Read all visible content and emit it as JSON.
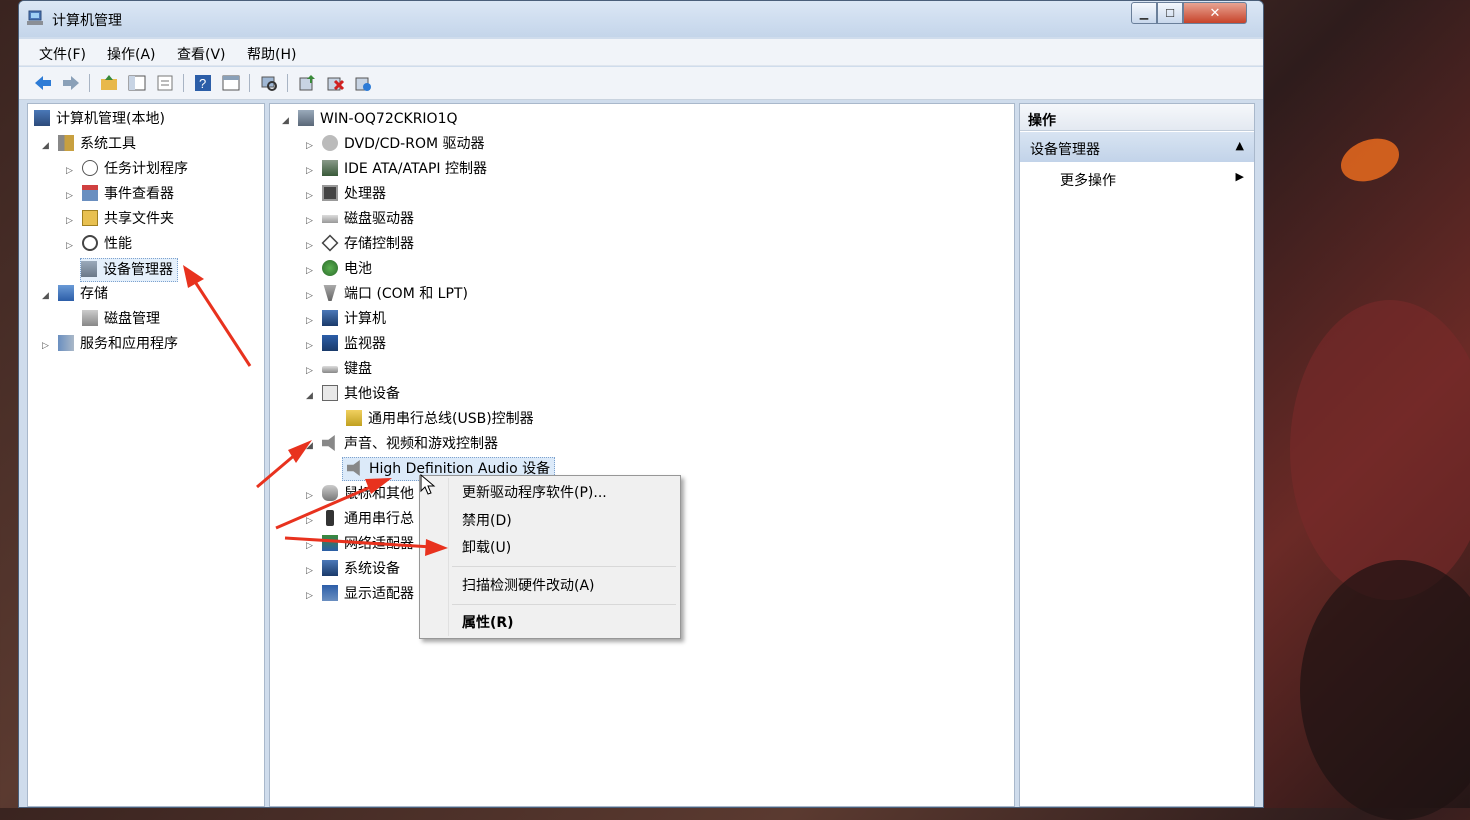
{
  "window": {
    "title": "计算机管理"
  },
  "menubar": [
    "文件(F)",
    "操作(A)",
    "查看(V)",
    "帮助(H)"
  ],
  "toolbar_icons": [
    "back-icon",
    "forward-icon",
    "up-folder-icon",
    "show-tree-icon",
    "export-icon",
    "help-icon",
    "console-tree-icon",
    "scan-icon",
    "update-driver-icon",
    "uninstall-icon",
    "enable-icon"
  ],
  "left_tree": {
    "root": "计算机管理(本地)",
    "system_tools": "系统工具",
    "task_scheduler": "任务计划程序",
    "event_viewer": "事件查看器",
    "shared_folders": "共享文件夹",
    "performance": "性能",
    "device_manager": "设备管理器",
    "storage": "存储",
    "disk_management": "磁盘管理",
    "services_apps": "服务和应用程序"
  },
  "device_tree": {
    "root": "WIN-OQ72CKRIO1Q",
    "dvd": "DVD/CD-ROM 驱动器",
    "ide": "IDE ATA/ATAPI 控制器",
    "processor": "处理器",
    "disk": "磁盘驱动器",
    "storage_ctrl": "存储控制器",
    "battery": "电池",
    "ports": "端口 (COM 和 LPT)",
    "computer": "计算机",
    "monitor": "监视器",
    "keyboard": "键盘",
    "other": "其他设备",
    "usb_ctrl": "通用串行总线(USB)控制器",
    "sound": "声音、视频和游戏控制器",
    "hd_audio": "High Definition Audio 设备",
    "mouse": "鼠标和其他",
    "usb": "通用串行总",
    "network": "网络适配器",
    "system": "系统设备",
    "display": "显示适配器"
  },
  "context_menu": {
    "update_driver": "更新驱动程序软件(P)...",
    "disable": "禁用(D)",
    "uninstall": "卸载(U)",
    "scan": "扫描检测硬件改动(A)",
    "properties": "属性(R)"
  },
  "actions": {
    "header": "操作",
    "section": "设备管理器",
    "more": "更多操作"
  }
}
